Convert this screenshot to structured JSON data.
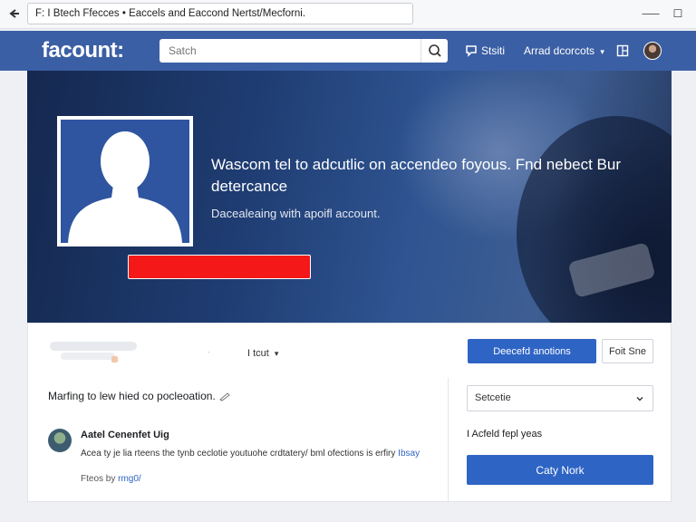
{
  "browser": {
    "url": "F: I Btech Ffecces • Eaccels and Eaccond Nertst/Mecforni.",
    "minimize": "⸺",
    "maximize": "☐"
  },
  "topbar": {
    "logo": "facount:",
    "search_placeholder": "Satch",
    "nav": {
      "status_label": "Stsiti",
      "account_label": "Arrad dcorcots"
    }
  },
  "cover": {
    "headline": "Wascom tel to adcutlic on accendeo foyous. Fnd nebect Bur detercance",
    "subline": "Dacealeaing with apoifl account."
  },
  "profile": {
    "mini_mark": "·",
    "dropdown_label": "I tcut"
  },
  "actions": {
    "primary_label": "Deecefd anotions",
    "secondary_label": "Foit Sne"
  },
  "feed": {
    "status_line": "Marfing to lew hied co pocleoation.",
    "post": {
      "author": "Aatel Cenenfet Uig",
      "text": "Acea ty je lia rteens the tynb ceclotie youtuohe crdtatery/ bml ofections is erfiry ",
      "text_link": "Ibsay",
      "meta": "Fteos by ",
      "meta_link": "rmg0/"
    }
  },
  "sidebar": {
    "select_value": "Setcetie",
    "option_label": "I Acfeld fepl yeas",
    "button_label": "Caty Nork"
  },
  "colors": {
    "brand_blue": "#3b5fa5",
    "button_blue": "#2e64c4",
    "alert_red": "#f51818"
  }
}
